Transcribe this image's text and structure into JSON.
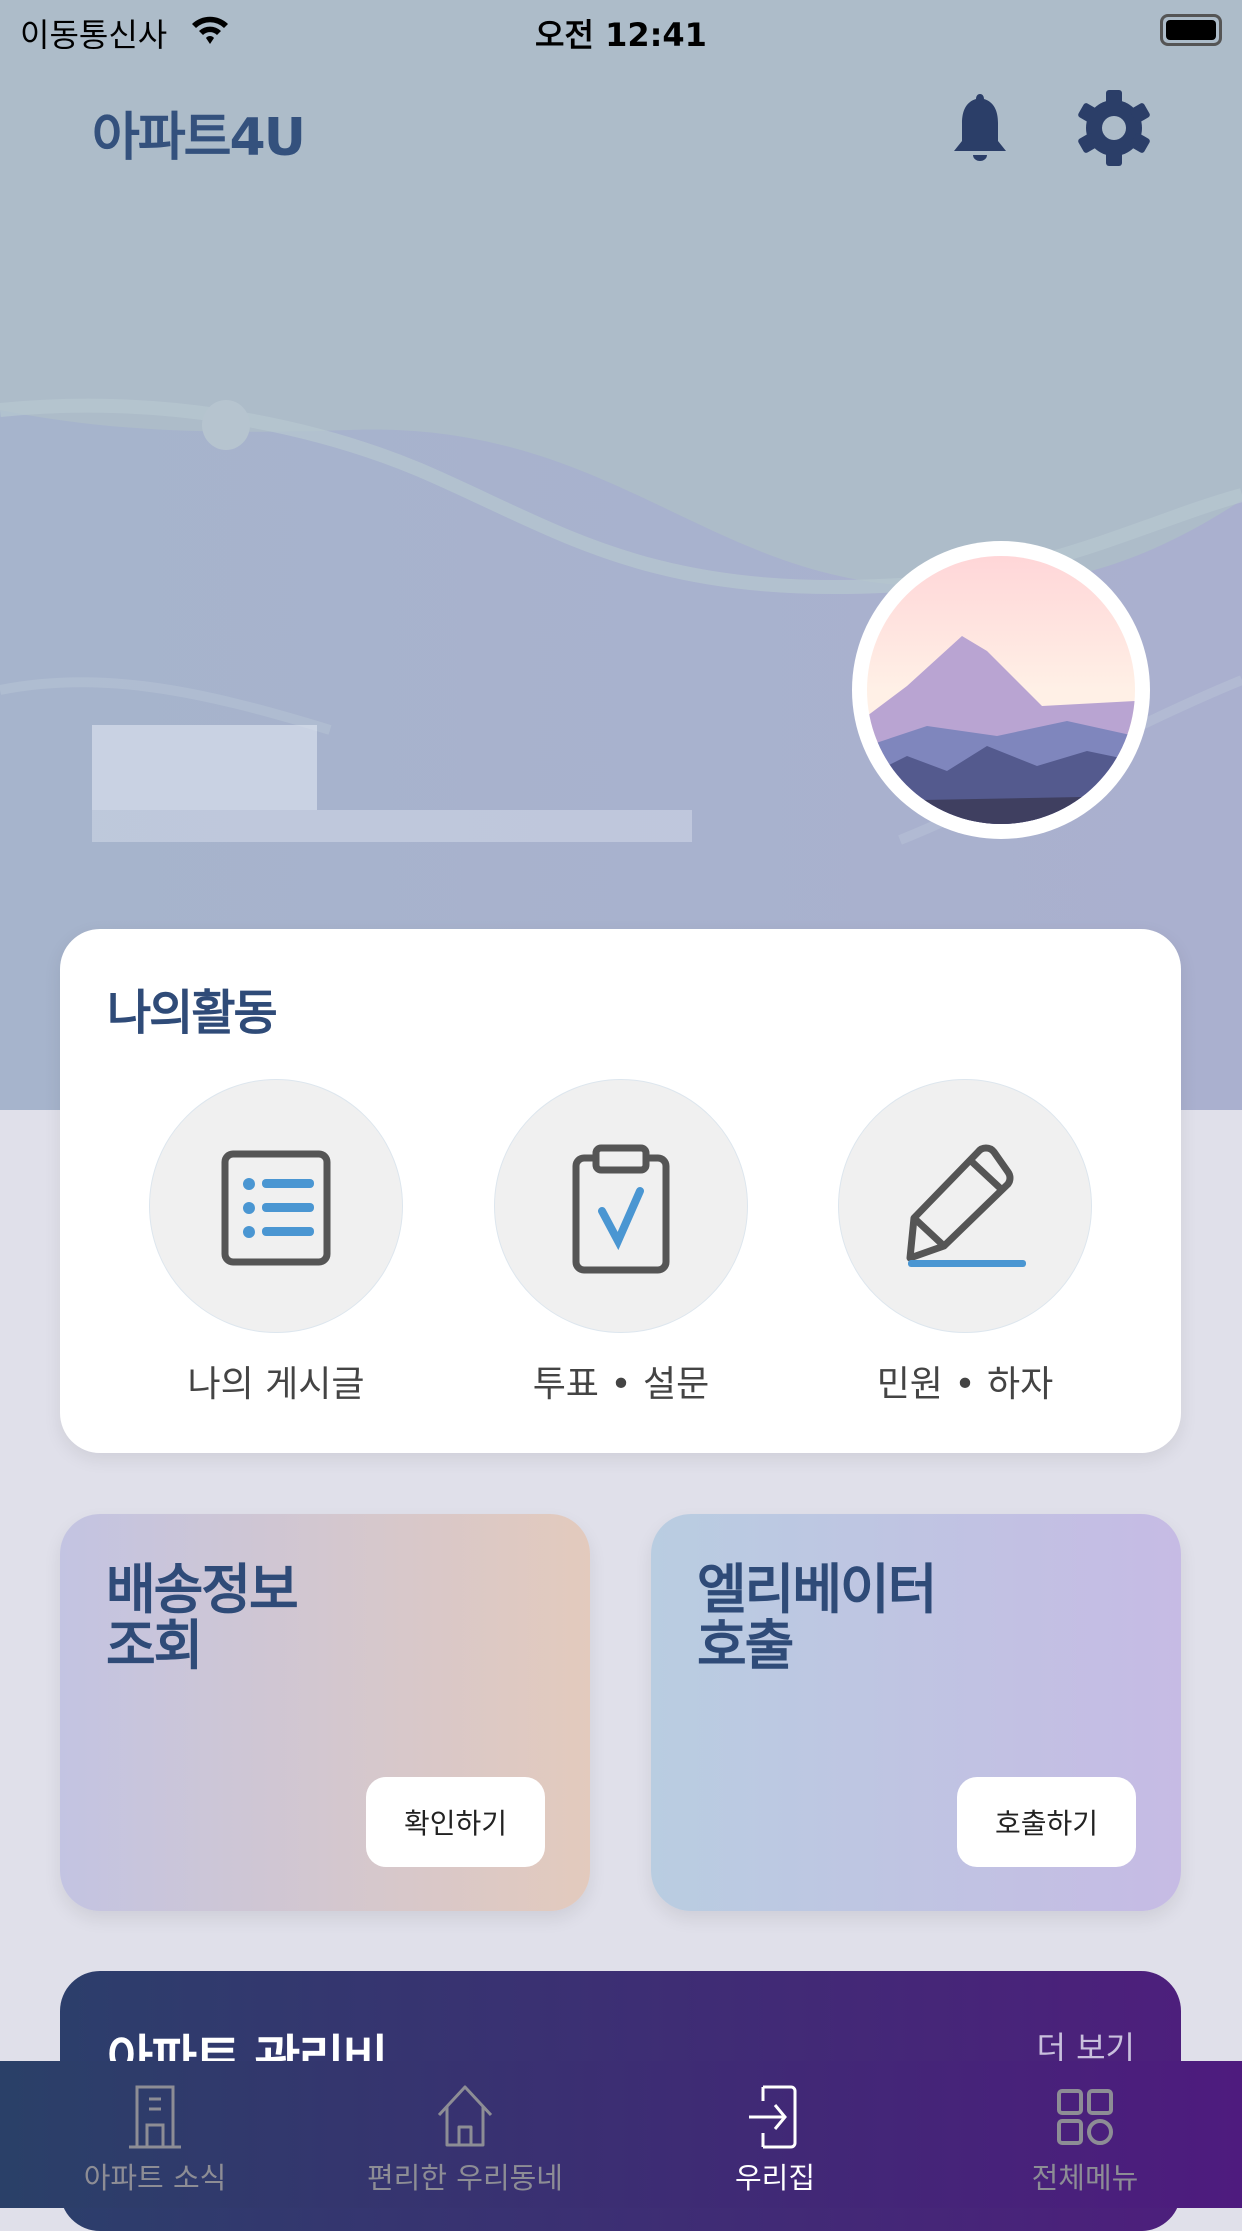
{
  "status_bar": {
    "carrier": "이동통신사",
    "time": "오전 12:41"
  },
  "header": {
    "app_title": "아파트4U"
  },
  "my_activity": {
    "title": "나의활동",
    "items": [
      {
        "label": "나의 게시글",
        "icon": "list-icon"
      },
      {
        "label": "투표 • 설문",
        "icon": "clipboard-check-icon"
      },
      {
        "label": "민원 • 하자",
        "icon": "pencil-icon"
      }
    ]
  },
  "cards": [
    {
      "title_line1": "배송정보",
      "title_line2": "조회",
      "button": "확인하기"
    },
    {
      "title_line1": "엘리베이터",
      "title_line2": "호출",
      "button": "호출하기"
    }
  ],
  "fee": {
    "title": "아파트 관리비",
    "more": "더 보기"
  },
  "tabbar": {
    "items": [
      {
        "label": "아파트 소식"
      },
      {
        "label": "편리한 우리동네"
      },
      {
        "label": "우리집",
        "active": true
      },
      {
        "label": "전체메뉴"
      }
    ]
  },
  "colors": {
    "primary": "#2f4b78",
    "tab_start": "#2a4068",
    "tab_end": "#4e1b7e",
    "accent_blue": "#4a96d2"
  }
}
